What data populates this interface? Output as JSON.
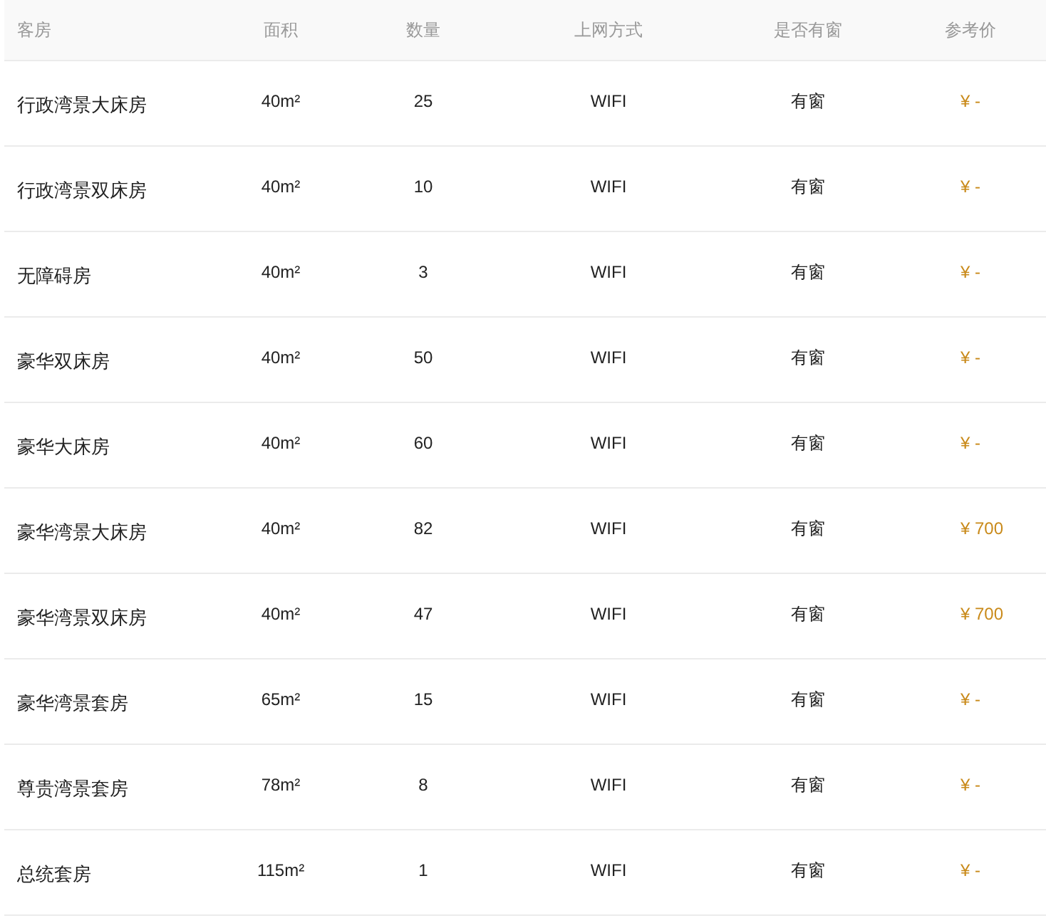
{
  "table": {
    "columns": [
      "客房",
      "面积",
      "数量",
      "上网方式",
      "是否有窗",
      "参考价"
    ],
    "rows": [
      [
        "行政湾景大床房",
        "40m²",
        "25",
        "WIFI",
        "有窗",
        "¥ -"
      ],
      [
        "行政湾景双床房",
        "40m²",
        "10",
        "WIFI",
        "有窗",
        "¥ -"
      ],
      [
        "无障碍房",
        "40m²",
        "3",
        "WIFI",
        "有窗",
        "¥ -"
      ],
      [
        "豪华双床房",
        "40m²",
        "50",
        "WIFI",
        "有窗",
        "¥ -"
      ],
      [
        "豪华大床房",
        "40m²",
        "60",
        "WIFI",
        "有窗",
        "¥ -"
      ],
      [
        "豪华湾景大床房",
        "40m²",
        "82",
        "WIFI",
        "有窗",
        "¥ 700"
      ],
      [
        "豪华湾景双床房",
        "40m²",
        "47",
        "WIFI",
        "有窗",
        "¥ 700"
      ],
      [
        "豪华湾景套房",
        "65m²",
        "15",
        "WIFI",
        "有窗",
        "¥ -"
      ],
      [
        "尊贵湾景套房",
        "78m²",
        "8",
        "WIFI",
        "有窗",
        "¥ -"
      ],
      [
        "总统套房",
        "115m²",
        "1",
        "WIFI",
        "有窗",
        "¥ -"
      ]
    ]
  }
}
